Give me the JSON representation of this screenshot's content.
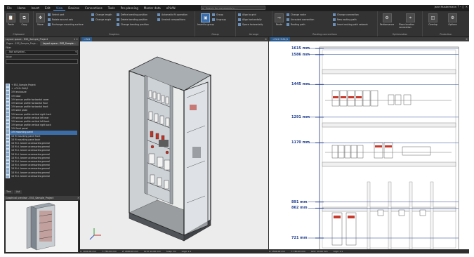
{
  "menu": {
    "items": [
      "File",
      "Home",
      "Insert",
      "Edit",
      "View",
      "Devices",
      "Connections",
      "Tools",
      "Pre-planning",
      "Master data",
      "ePLAN"
    ],
    "active_index": 4,
    "search_placeholder": "Search for commands in ...",
    "user": "Jane Mustermann",
    "window_controls": "? – ◻ ✕"
  },
  "ribbon": {
    "groups": [
      {
        "label": "Clipboard",
        "buttons": [
          "Paste",
          "Copy"
        ]
      },
      {
        "label": "Graphics",
        "buttons": [
          "Move"
        ],
        "small": [
          "Select part",
          "Rotate around axis",
          "Exchange mounting surface",
          "Change length",
          "Change angle",
          "Define bending position",
          "Delete bending position",
          "Change bending position",
          "Automatic fit operation",
          "Unwind compositions"
        ]
      },
      {
        "label": "Group",
        "buttons": [
          "Insert to group",
          "Group",
          "Ungroup"
        ]
      },
      {
        "label": "Arrange",
        "small": [
          "Align to grid",
          "Align horizontally",
          "Space horizontally"
        ]
      },
      {
        "label": "Routing connections",
        "buttons": [
          "Route"
        ],
        "small": [
          "Change route",
          "Unrouted connection",
          "Routing path",
          "Change connection",
          "New routing path",
          "Insert routing path network"
        ]
      },
      {
        "label": "Optimization",
        "buttons": [
          "Performance",
          "Place location connection"
        ]
      },
      {
        "label": "Protection",
        "buttons": [
          "Overlap",
          "Options"
        ]
      }
    ]
  },
  "left_panel": {
    "title": "Layout space - ESS_Sample_Project",
    "tabs": [
      "Pages - ESS_Sample_Proje...",
      "Layout space - ESS_Sample..."
    ],
    "filter_label": "Filter",
    "filter_value": "- Not activated -",
    "value_label": "Value",
    "tree": [
      "+ ESS_Sample_Project",
      "+ =CA1+EAA/1",
      "  3 M enclosure",
      "  3 M door",
      "  3 M sensor profile horizontal cover",
      "  3 M sensor profile horizontal floor",
      "  3 M sensor profile horizontal front",
      "  3 M steel plate",
      "  3 M sensor profile vertical right front",
      "  3 M sensor profile vertical left rear",
      "  3 M sensor profile vertical left back",
      "  3 M sensor profile vertical right back",
      "  3 M front panel",
      "  3 M mounting panel",
      "  18 M mounting panel front",
      "  18 M mounting panel back",
      "  18 M cl. bearer accessories general",
      "  18 M cl. bearer accessories general",
      "  18 M cl. bearer accessories general",
      "  18 M cl. bearer accessories general",
      "  18 M cl. bearer accessories general",
      "  18 M cl. bearer accessories general",
      "  18 M cl. bearer accessories general",
      "  18 M cl. bearer accessories general",
      "  18 M cl. bearer accessories general",
      "  18 M cl. bearer accessories general"
    ],
    "selected_index": 13,
    "bottom_tabs": [
      "Tree",
      "List"
    ],
    "preview_title": "Graphical preview - ESS_Sample_Project"
  },
  "view3d": {
    "tab": "=EA1",
    "status": [
      "X: 1000.00 mm",
      "Y: 750.00 mm",
      "Z: 2000.00 mm",
      "Grid: 10.00 mm",
      "Snap: On",
      "Logic 1:1"
    ]
  },
  "view2d": {
    "tab": "=EA1+EA1/1",
    "dimensions": [
      "1615 mm",
      "1586 mm",
      "1445 mm",
      "1291 mm",
      "1170 mm",
      "891 mm",
      "862 mm",
      "721 mm"
    ],
    "dimension_values_mm": [
      1615,
      1586,
      1445,
      1291,
      1170,
      891,
      862,
      721
    ],
    "status": [
      "X: 1560.00 mm",
      "Y: 740.00 mm",
      "Grid: 10.00 mm",
      "Logic 1:1"
    ]
  },
  "colors": {
    "accent": "#3b6ea8",
    "dimension": "#1f3d8f"
  }
}
